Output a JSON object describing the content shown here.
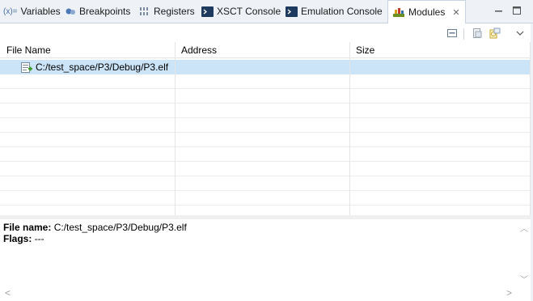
{
  "tabs": [
    {
      "id": "variables",
      "label": "Variables",
      "icon_text": "(x)="
    },
    {
      "id": "breakpoints",
      "label": "Breakpoints",
      "icon": "breakpoints-icon"
    },
    {
      "id": "registers",
      "label": "Registers",
      "icon_text": "1010\n0101"
    },
    {
      "id": "xsct-console",
      "label": "XSCT Console",
      "icon": "console-icon"
    },
    {
      "id": "emulation-console",
      "label": "Emulation Console",
      "icon": "console-icon"
    },
    {
      "id": "modules",
      "label": "Modules",
      "icon": "modules-icon",
      "active": true,
      "closable": true
    }
  ],
  "table": {
    "columns": [
      "File Name",
      "Address",
      "Size"
    ],
    "rows": [
      {
        "file_name": "C:/test_space/P3/Debug/P3.elf",
        "address": "",
        "size": "",
        "selected": true
      }
    ]
  },
  "details": {
    "file_name_label": "File name:",
    "file_name_value": "C:/test_space/P3/Debug/P3.elf",
    "flags_label": "Flags:",
    "flags_value": "---"
  },
  "colors": {
    "tabbar_bg": "#eef1f6",
    "selection": "#cce4f7",
    "console_icon_bg": "#1f3a5f"
  }
}
